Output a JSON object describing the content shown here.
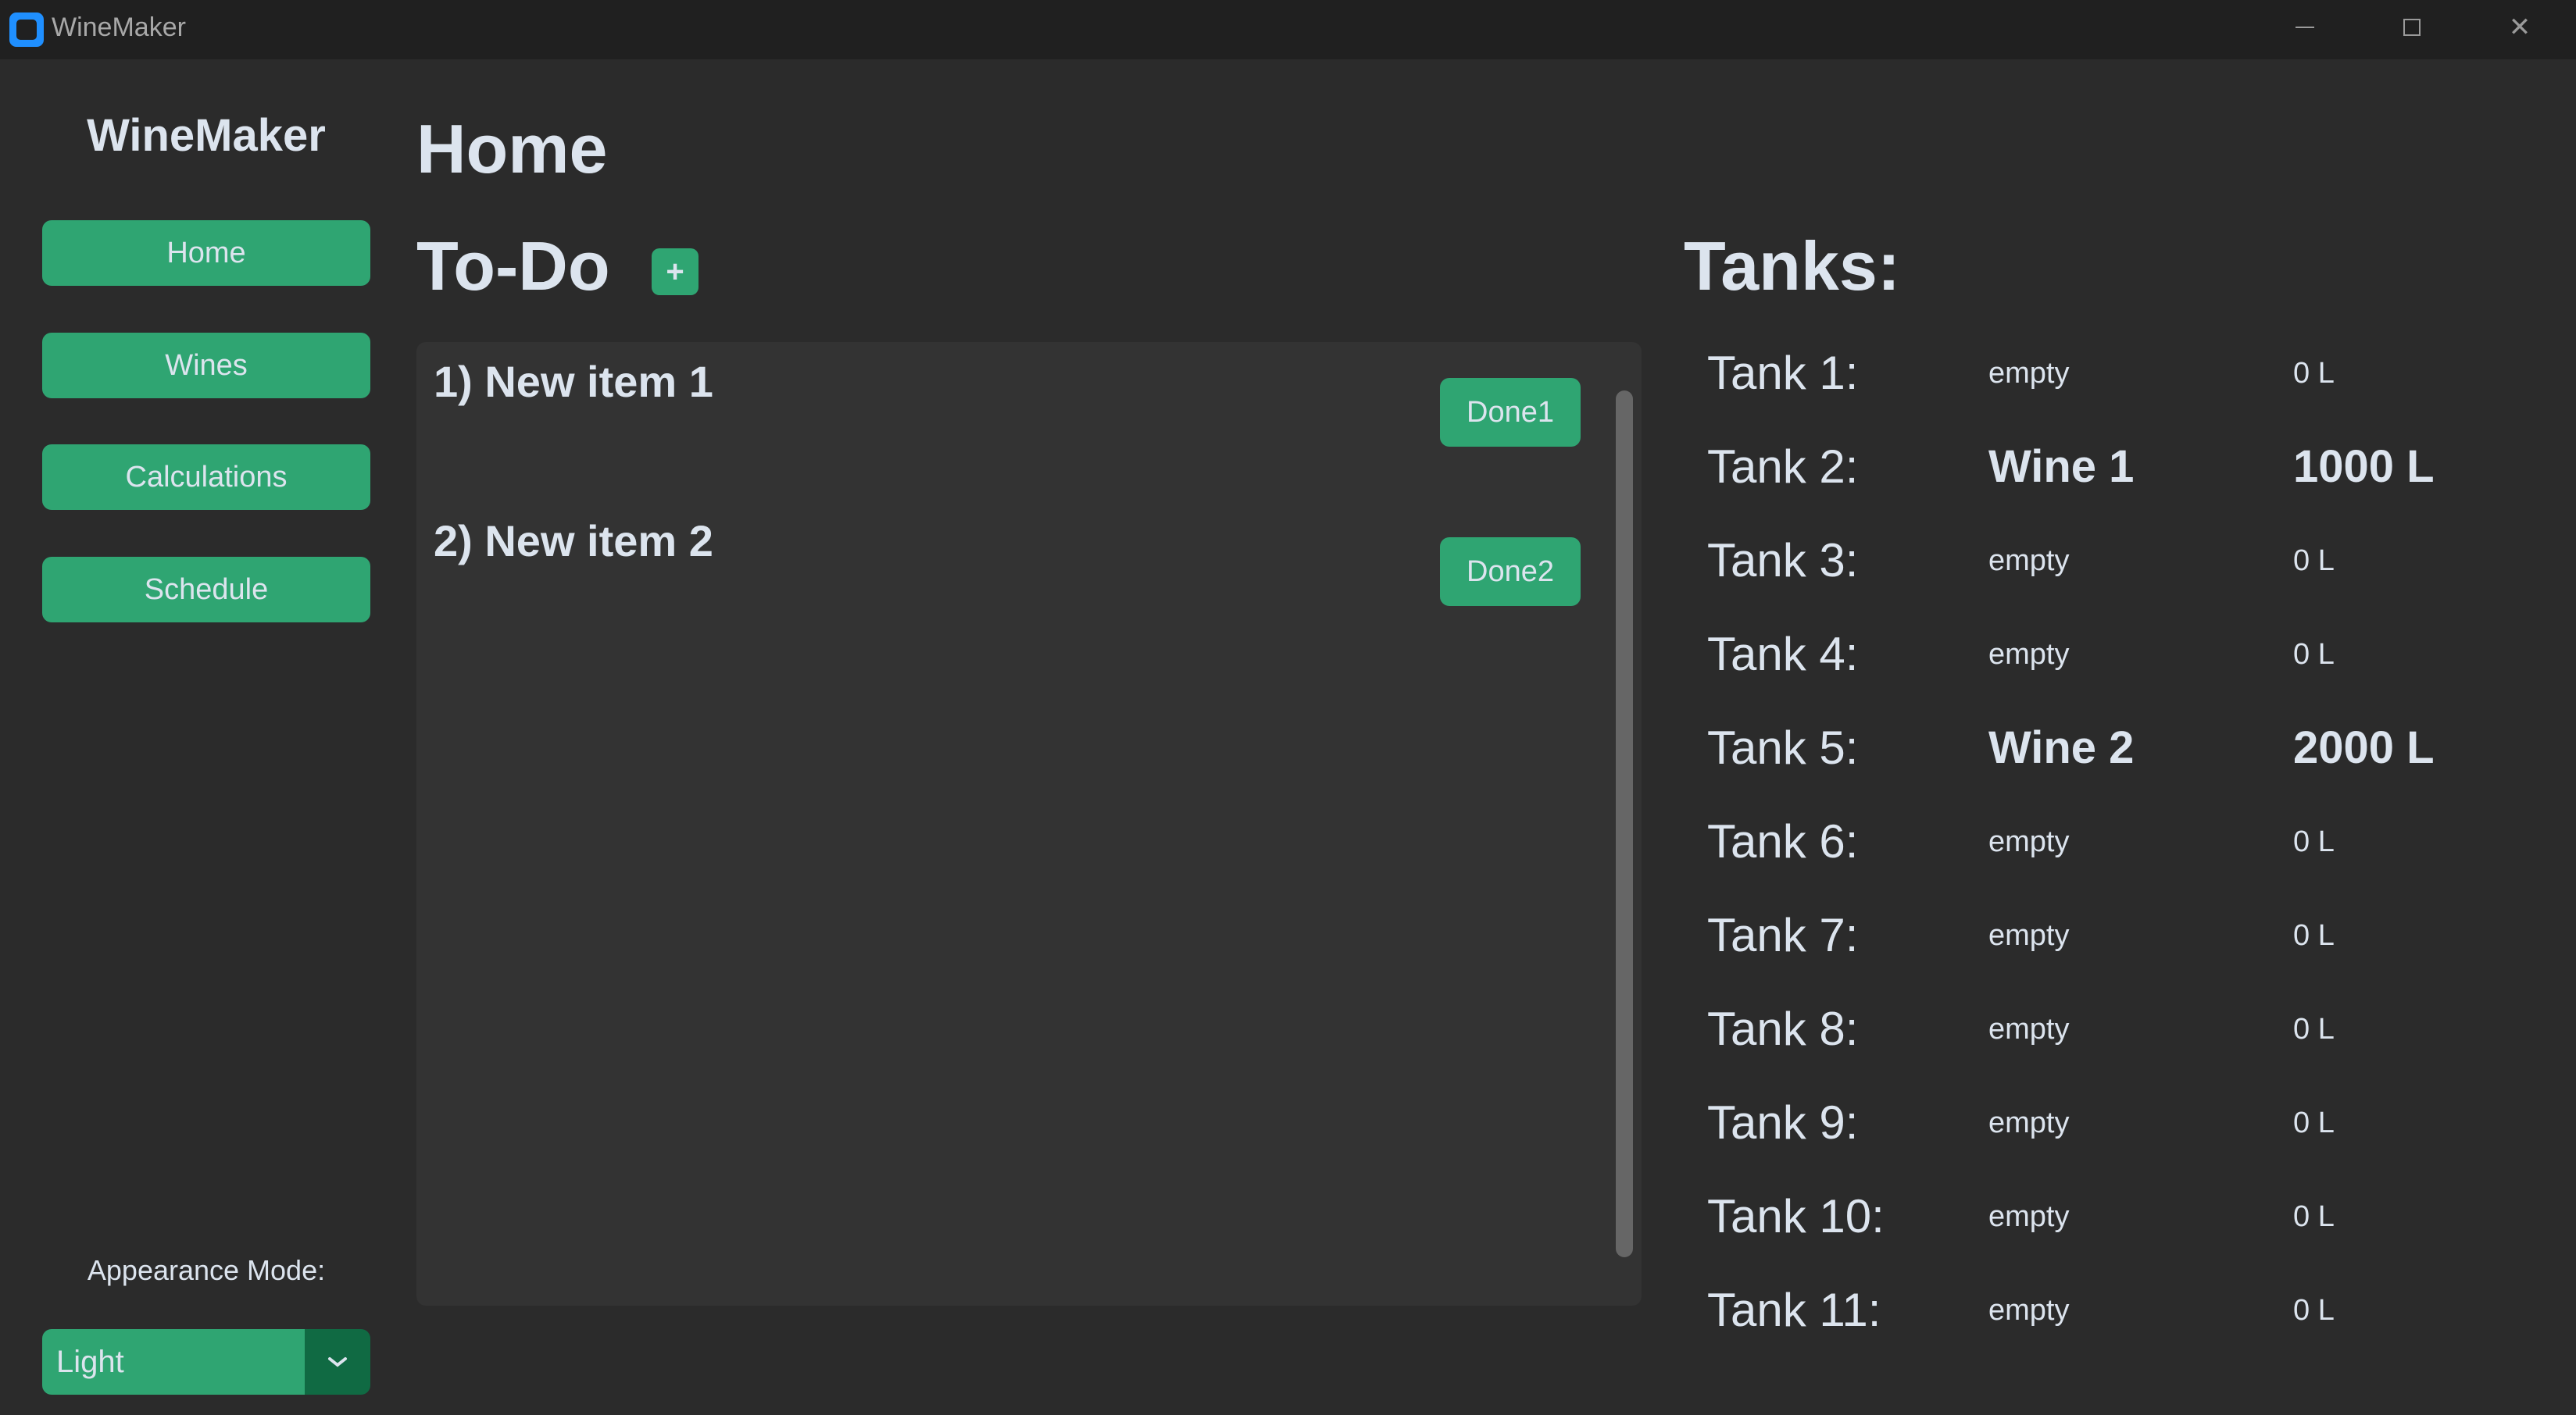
{
  "window": {
    "title": "WineMaker",
    "controls": {
      "minimize": "minimize-icon",
      "maximize": "maximize-icon",
      "close": "close-icon"
    }
  },
  "sidebar": {
    "title": "WineMaker",
    "nav": [
      {
        "label": "Home"
      },
      {
        "label": "Wines"
      },
      {
        "label": "Calculations"
      },
      {
        "label": "Schedule"
      }
    ],
    "appearance_label": "Appearance Mode:",
    "appearance_value": "Light"
  },
  "main": {
    "title": "Home",
    "todo": {
      "heading": "To-Do",
      "add_label": "+",
      "items": [
        {
          "text": "1) New item 1",
          "done_label": "Done1"
        },
        {
          "text": "2) New item 2",
          "done_label": "Done2"
        }
      ]
    },
    "tanks": {
      "heading": "Tanks:",
      "rows": [
        {
          "name": "Tank 1:",
          "content": "empty",
          "volume": "0 L"
        },
        {
          "name": "Tank 2:",
          "content": "Wine 1",
          "volume": "1000 L"
        },
        {
          "name": "Tank 3:",
          "content": "empty",
          "volume": "0 L"
        },
        {
          "name": "Tank 4:",
          "content": "empty",
          "volume": "0 L"
        },
        {
          "name": "Tank 5:",
          "content": "Wine 2",
          "volume": "2000 L"
        },
        {
          "name": "Tank 6:",
          "content": "empty",
          "volume": "0 L"
        },
        {
          "name": "Tank 7:",
          "content": "empty",
          "volume": "0 L"
        },
        {
          "name": "Tank 8:",
          "content": "empty",
          "volume": "0 L"
        },
        {
          "name": "Tank 9:",
          "content": "empty",
          "volume": "0 L"
        },
        {
          "name": "Tank 10:",
          "content": "empty",
          "volume": "0 L"
        },
        {
          "name": "Tank 11:",
          "content": "empty",
          "volume": "0 L"
        }
      ]
    }
  },
  "colors": {
    "accent": "#2fa572",
    "accent_dark": "#106a43",
    "background": "#2b2b2b",
    "titlebar": "#202020",
    "panel": "#333333",
    "text": "#dce4ee"
  }
}
